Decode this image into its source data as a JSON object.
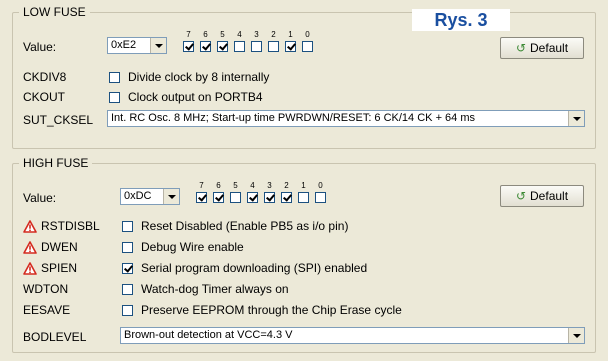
{
  "badge": "Rys. 3",
  "low_fuse": {
    "title": "LOW FUSE",
    "value_label": "Value:",
    "value": "0xE2",
    "bit_numbers": [
      "7",
      "6",
      "5",
      "4",
      "3",
      "2",
      "1",
      "0"
    ],
    "bits_checked": [
      true,
      true,
      true,
      false,
      false,
      false,
      true,
      false
    ],
    "default_label": "Default",
    "rows": [
      {
        "name": "CKDIV8",
        "checked": false,
        "desc": "Divide clock by 8 internally"
      },
      {
        "name": "CKOUT",
        "checked": false,
        "desc": "Clock output on PORTB4"
      }
    ],
    "sut_label": "SUT_CKSEL",
    "sut_value": "Int. RC Osc. 8 MHz; Start-up time PWRDWN/RESET: 6 CK/14 CK + 64 ms"
  },
  "high_fuse": {
    "title": "HIGH FUSE",
    "value_label": "Value:",
    "value": "0xDC",
    "bit_numbers": [
      "7",
      "6",
      "5",
      "4",
      "3",
      "2",
      "1",
      "0"
    ],
    "bits_checked": [
      true,
      true,
      false,
      true,
      true,
      true,
      false,
      false
    ],
    "default_label": "Default",
    "rows": [
      {
        "name": "RSTDISBL",
        "warn": true,
        "checked": false,
        "desc": "Reset Disabled (Enable PB5 as i/o pin)"
      },
      {
        "name": "DWEN",
        "warn": true,
        "checked": false,
        "desc": "Debug Wire enable"
      },
      {
        "name": "SPIEN",
        "warn": true,
        "checked": true,
        "desc": "Serial program downloading (SPI) enabled"
      },
      {
        "name": "WDTON",
        "warn": false,
        "checked": false,
        "desc": "Watch-dog Timer always on"
      },
      {
        "name": "EESAVE",
        "warn": false,
        "checked": false,
        "desc": "Preserve EEPROM through the Chip Erase cycle"
      }
    ],
    "bod_label": "BODLEVEL",
    "bod_value": "Brown-out detection at VCC=4.3 V"
  },
  "colors": {
    "warning": "#d42a1f",
    "default_icon": "#3d8a36",
    "badge_text": "#1a4fa0"
  },
  "icons": {
    "warning": "warning-triangle-icon",
    "default": "reset-arrow-icon",
    "dropdown": "chevron-down-icon"
  }
}
